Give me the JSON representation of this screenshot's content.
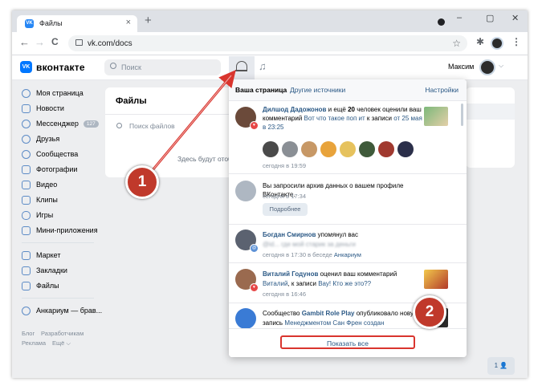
{
  "browser": {
    "tab_title": "Файлы",
    "tab_favicon": "VK",
    "tab_close": "×",
    "new_tab": "+",
    "url": "vk.com/docs",
    "win_controls": [
      "–",
      "▢",
      "✕"
    ],
    "nav": [
      "←",
      "→",
      "C"
    ]
  },
  "header": {
    "logo_letters": "VK",
    "site_name": "вконтакте",
    "search_placeholder": "Поиск",
    "music_icon": "♫",
    "user_name": "Максим",
    "caret": "⌵"
  },
  "sidebar": {
    "group1": [
      {
        "label": "Моя страница"
      },
      {
        "label": "Новости"
      },
      {
        "label": "Мессенджер",
        "badge": "127"
      },
      {
        "label": "Друзья"
      },
      {
        "label": "Сообщества"
      },
      {
        "label": "Фотографии"
      },
      {
        "label": "Видео"
      },
      {
        "label": "Клипы"
      },
      {
        "label": "Игры"
      },
      {
        "label": "Мини-приложения"
      }
    ],
    "group2": [
      {
        "label": "Маркет"
      },
      {
        "label": "Закладки"
      },
      {
        "label": "Файлы"
      }
    ],
    "group3": [
      {
        "label": "Анкариум — брав..."
      }
    ],
    "footer": {
      "blog": "Блог",
      "developers": "Разработчикам",
      "ads": "Реклама",
      "more": "Ещё ⌵"
    }
  },
  "docs": {
    "title": "Файлы",
    "search_placeholder": "Поиск файлов",
    "empty_text": "Здесь будут отображаться"
  },
  "popup": {
    "tab_active": "Ваша страница",
    "tab_other": "Другие источники",
    "settings": "Настройки",
    "items": [
      {
        "name": "Дилшод Дадожонов",
        "text_a": " и ещё ",
        "count": "20",
        "text_b": " человек оценили ваш комментарий ",
        "link": "Вот что такое поп ит",
        "text_c": " к записи ",
        "date_link": "от 25 мая в 23:25",
        "time": "сегодня в 19:59"
      },
      {
        "text": "Вы запросили архив данных о вашем профиле ВКонтакте.",
        "time": "сегодня в 17:34",
        "button": "Подробнее"
      },
      {
        "name": "Богдан Смирнов",
        "text_a": " упомянул вас",
        "quote": "@id... где мой старик за деньги",
        "time_a": "сегодня в 17:30 в беседе ",
        "chat": "Анкариум"
      },
      {
        "name": "Виталий Годунов",
        "text_a": " оценил ваш комментарий",
        "reply": "Виталий",
        "text_b": ", к записи ",
        "post": "Вау! Кто же это??",
        "time": "сегодня в 16:46"
      },
      {
        "text_a": "Сообщество ",
        "name": "Gambit Role Play",
        "text_b": " опубликовало новую",
        "text_c": "запись ",
        "post": "Менеджментом Сан Френ создан"
      }
    ],
    "show_all": "Показать все"
  },
  "chat_button": "1 👤",
  "annotations": [
    "1",
    "2"
  ],
  "colors": {
    "vk_blue": "#0077ff",
    "link": "#2a5885",
    "marker": "#c0392b",
    "highlight": "#d9352e"
  }
}
